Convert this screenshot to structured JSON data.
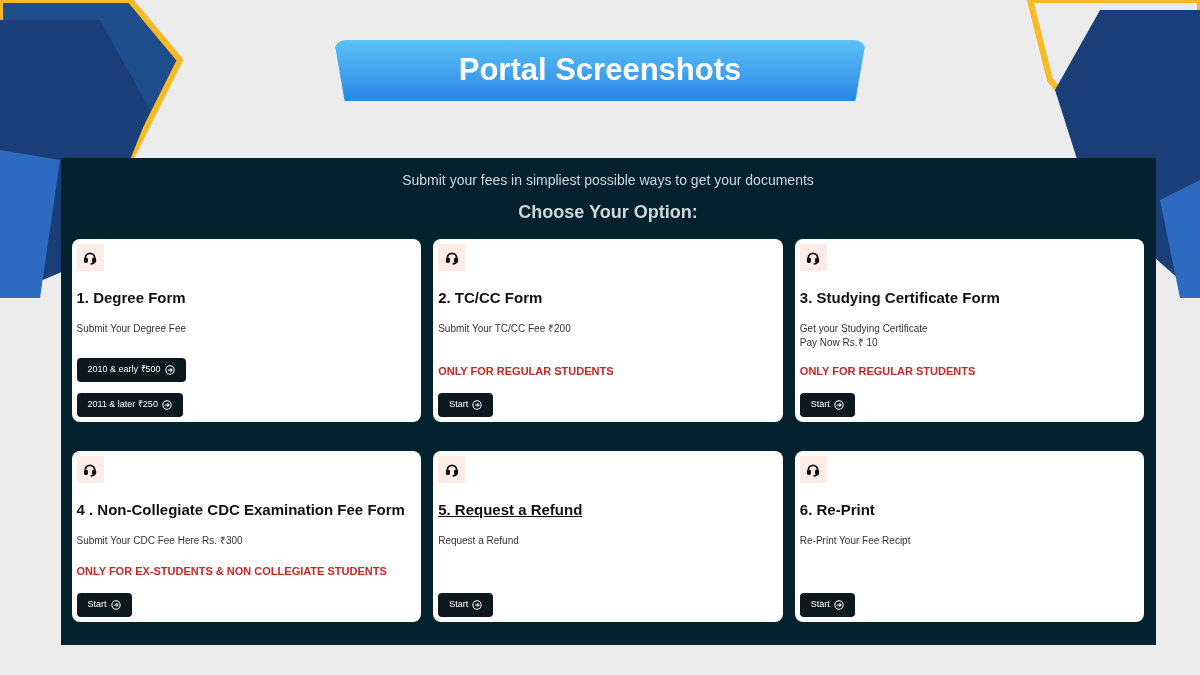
{
  "banner": {
    "title": "Portal Screenshots"
  },
  "panel": {
    "subtitle": "Submit your fees in simpliest possible ways to get your documents",
    "heading": "Choose Your Option:"
  },
  "cards": [
    {
      "title": "1. Degree Form",
      "link": false,
      "description": [
        "Submit Your Degree Fee"
      ],
      "buttons": [
        "2010 & early ₹500",
        "2011 & later ₹250"
      ]
    },
    {
      "title": "2. TC/CC Form",
      "link": false,
      "description": [
        "Submit Your TC/CC Fee ₹200"
      ],
      "notice": "ONLY FOR REGULAR STUDENTS",
      "buttons": [
        "Start"
      ]
    },
    {
      "title": "3. Studying Certificate Form",
      "link": false,
      "description": [
        "Get your Studying Certificate",
        "Pay Now Rs.₹ 10"
      ],
      "notice": "ONLY FOR REGULAR STUDENTS",
      "buttons": [
        "Start"
      ]
    },
    {
      "title": "4 . Non-Collegiate CDC Examination Fee Form",
      "link": false,
      "description": [
        "Submit Your CDC Fee Here Rs. ₹300"
      ],
      "notice": "ONLY FOR EX-STUDENTS & NON COLLEGIATE STUDENTS",
      "buttons": [
        "Start"
      ]
    },
    {
      "title": "5. Request a Refund",
      "link": true,
      "description": [
        "Request a Refund"
      ],
      "buttons": [
        "Start"
      ]
    },
    {
      "title": "6. Re-Print",
      "link": false,
      "description": [
        "Re-Print Your Fee Recipt"
      ],
      "buttons": [
        "Start"
      ]
    }
  ]
}
